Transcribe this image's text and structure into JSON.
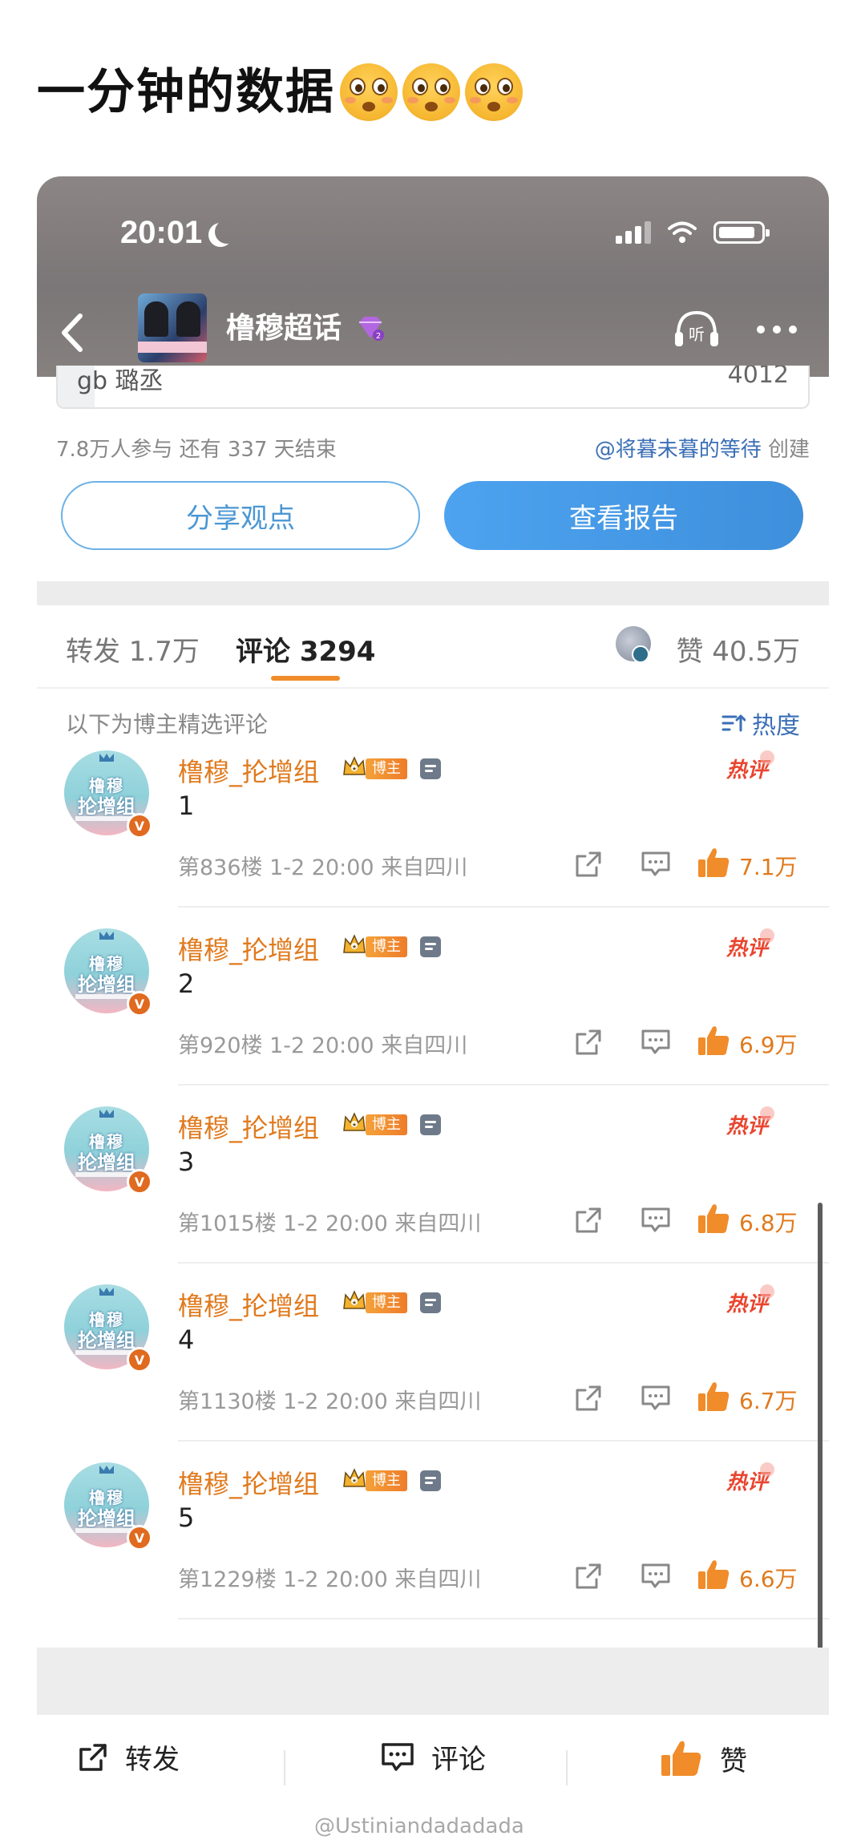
{
  "post": {
    "title": "一分钟的数据",
    "emoji_name": "flushed-face-emoji"
  },
  "status_bar": {
    "time": "20:01"
  },
  "topic": {
    "name": "橹穆超话",
    "vip_level": "2"
  },
  "vote": {
    "option_label": "gb 璐丞",
    "option_count": "4012",
    "participants": "7.8万人参与  还有 337 天结束",
    "creator": "@将暮未暮的等待",
    "created_label": "创建",
    "share_button": "分享观点",
    "report_button": "查看报告"
  },
  "tabs": {
    "repost": "转发 1.7万",
    "comment": "评论 3294",
    "likes": "赞 40.5万"
  },
  "comments_header": {
    "label": "以下为博主精选评论",
    "sort": "热度"
  },
  "comments": [
    {
      "name": "橹穆_抡增组",
      "badge": "博主",
      "hot": "热评",
      "text": "1",
      "meta": "第836楼 1-2 20:00 来自四川",
      "likes": "7.1万",
      "avatar_line1": "橹穆",
      "avatar_line2": "抡增组",
      "v": "V"
    },
    {
      "name": "橹穆_抡增组",
      "badge": "博主",
      "hot": "热评",
      "text": "2",
      "meta": "第920楼 1-2 20:00 来自四川",
      "likes": "6.9万",
      "avatar_line1": "橹穆",
      "avatar_line2": "抡增组",
      "v": "V"
    },
    {
      "name": "橹穆_抡增组",
      "badge": "博主",
      "hot": "热评",
      "text": "3",
      "meta": "第1015楼 1-2 20:00 来自四川",
      "likes": "6.8万",
      "avatar_line1": "橹穆",
      "avatar_line2": "抡增组",
      "v": "V"
    },
    {
      "name": "橹穆_抡增组",
      "badge": "博主",
      "hot": "热评",
      "text": "4",
      "meta": "第1130楼 1-2 20:00 来自四川",
      "likes": "6.7万",
      "avatar_line1": "橹穆",
      "avatar_line2": "抡增组",
      "v": "V"
    },
    {
      "name": "橹穆_抡增组",
      "badge": "博主",
      "hot": "热评",
      "text": "5",
      "meta": "第1229楼 1-2 20:00 来自四川",
      "likes": "6.6万",
      "avatar_line1": "橹穆",
      "avatar_line2": "抡增组",
      "v": "V"
    }
  ],
  "action_bar": {
    "repost": "转发",
    "comment": "评论",
    "like": "赞"
  },
  "watermark": "@Ustiniandadadada",
  "colors": {
    "accent_orange": "#e07a1e",
    "link_blue": "#3b6fb6",
    "button_blue": "#4da3ef",
    "hot_red": "#e9452f"
  }
}
